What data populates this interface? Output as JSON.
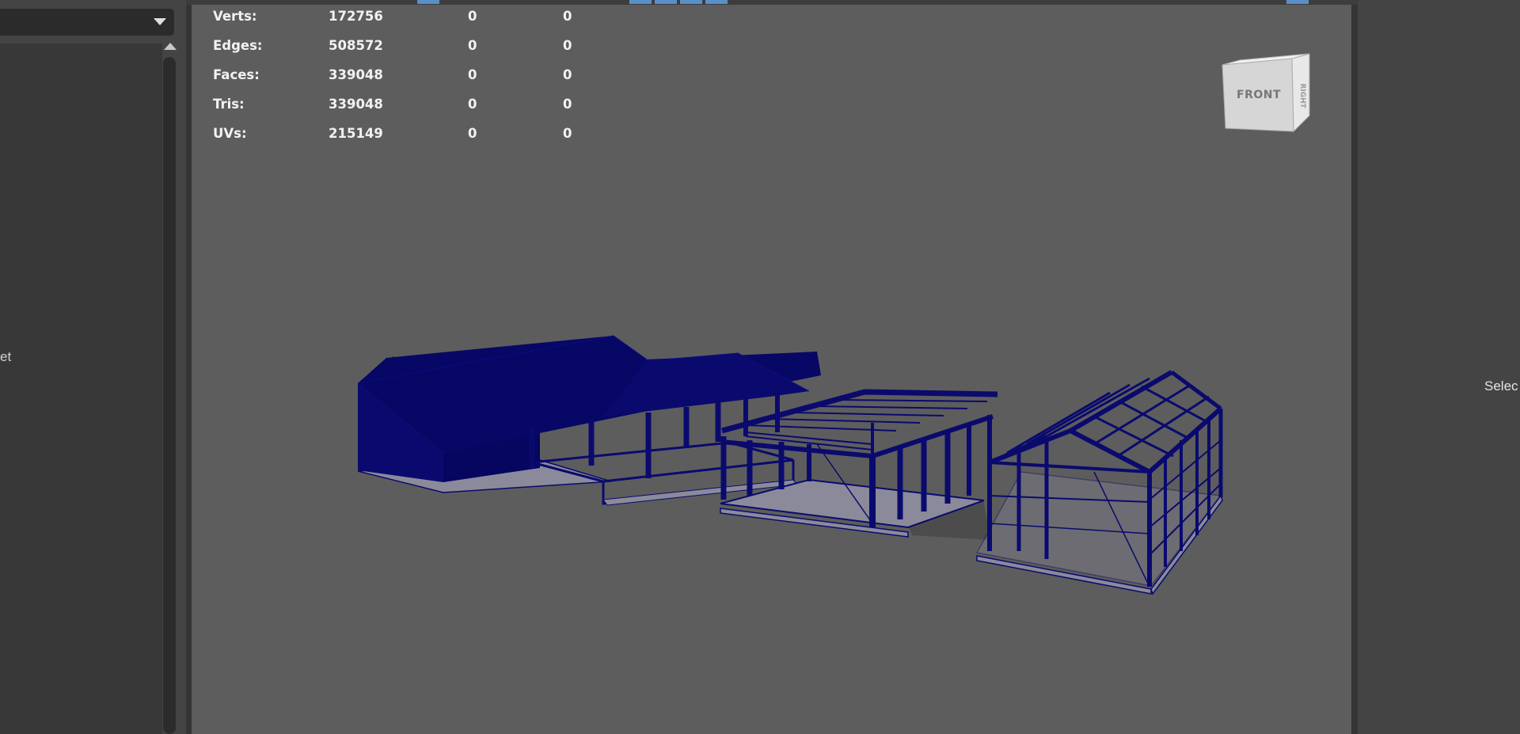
{
  "outliner": {
    "partial_label": "et"
  },
  "hud": {
    "rows": [
      {
        "label": "Verts:",
        "v1": "172756",
        "v2": "0",
        "v3": "0"
      },
      {
        "label": "Edges:",
        "v1": "508572",
        "v2": "0",
        "v3": "0"
      },
      {
        "label": "Faces:",
        "v1": "339048",
        "v2": "0",
        "v3": "0"
      },
      {
        "label": "Tris:",
        "v1": "339048",
        "v2": "0",
        "v3": "0"
      },
      {
        "label": "UVs:",
        "v1": "215149",
        "v2": "0",
        "v3": "0"
      }
    ]
  },
  "view_cube": {
    "face_label": "FRONT"
  },
  "right_panel": {
    "partial_label": "Selec"
  },
  "colors": {
    "wireframe": "#0a0a6e",
    "viewport_bg": "#5d5d5d",
    "panel_bg": "#444444",
    "accent_blue": "#5a8fc8"
  }
}
